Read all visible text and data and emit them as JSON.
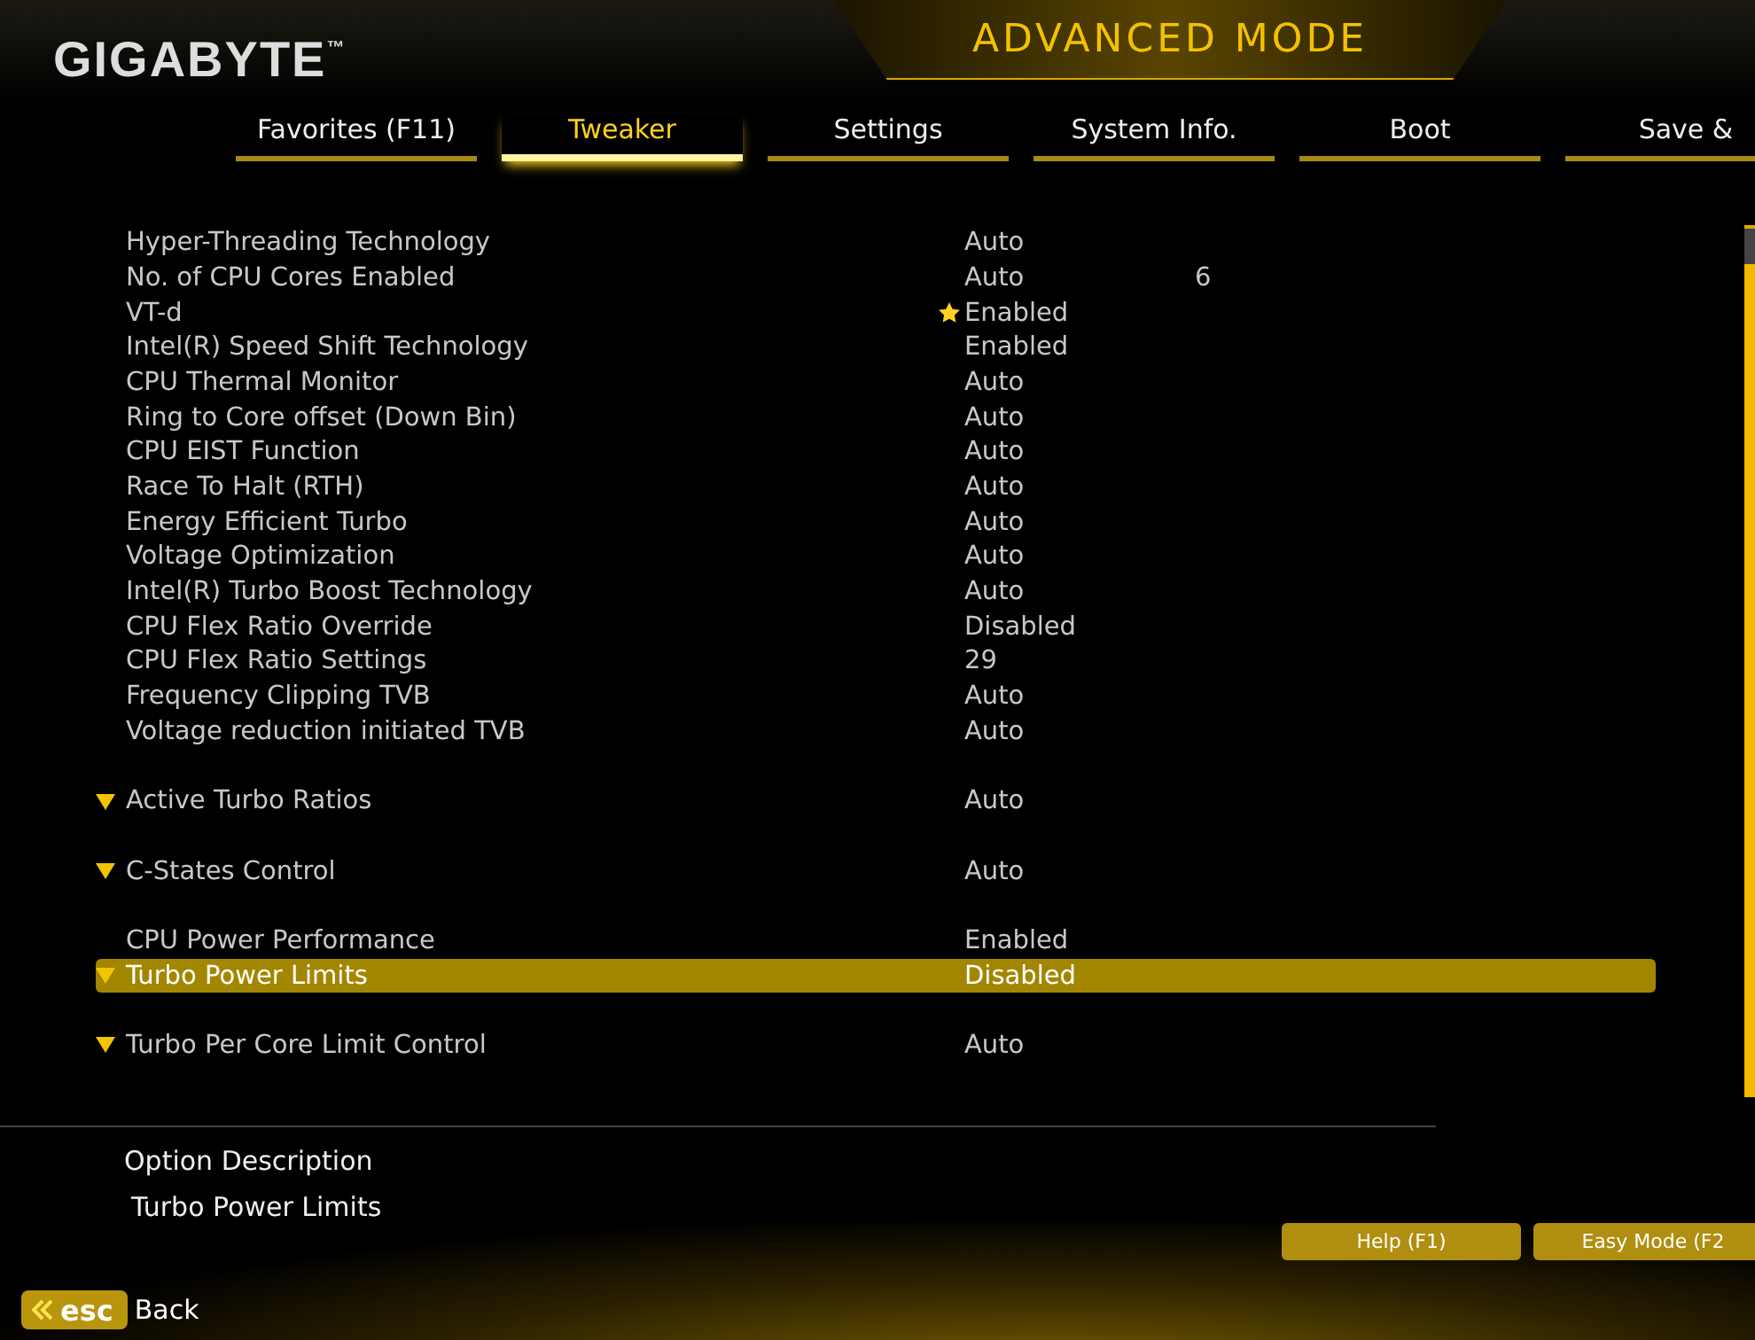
{
  "header": {
    "logo": "GIGABYTE",
    "trademark": "™",
    "mode_title": "ADVANCED MODE"
  },
  "tabs": [
    {
      "label": "Favorites (F11)",
      "selected": false
    },
    {
      "label": "Tweaker",
      "selected": true
    },
    {
      "label": "Settings",
      "selected": false
    },
    {
      "label": "System Info.",
      "selected": false
    },
    {
      "label": "Boot",
      "selected": false
    },
    {
      "label": "Save &",
      "selected": false
    }
  ],
  "settings": [
    {
      "kind": "setting",
      "label": "Hyper-Threading Technology",
      "value": "Auto",
      "favorite": false,
      "selected": false
    },
    {
      "kind": "setting",
      "label": "No. of CPU Cores Enabled",
      "value": "Auto",
      "extra": "6",
      "favorite": false,
      "selected": false
    },
    {
      "kind": "setting",
      "label": "VT-d",
      "value": "Enabled",
      "favorite": true,
      "selected": false
    },
    {
      "kind": "setting",
      "label": "Intel(R) Speed Shift Technology",
      "value": "Enabled",
      "favorite": false,
      "selected": false
    },
    {
      "kind": "setting",
      "label": "CPU Thermal Monitor",
      "value": "Auto",
      "favorite": false,
      "selected": false
    },
    {
      "kind": "setting",
      "label": "Ring to Core offset (Down Bin)",
      "value": "Auto",
      "favorite": false,
      "selected": false
    },
    {
      "kind": "setting",
      "label": "CPU EIST Function",
      "value": "Auto",
      "favorite": false,
      "selected": false
    },
    {
      "kind": "setting",
      "label": "Race To Halt (RTH)",
      "value": "Auto",
      "favorite": false,
      "selected": false
    },
    {
      "kind": "setting",
      "label": "Energy Efficient Turbo",
      "value": "Auto",
      "favorite": false,
      "selected": false
    },
    {
      "kind": "setting",
      "label": "Voltage Optimization",
      "value": "Auto",
      "favorite": false,
      "selected": false
    },
    {
      "kind": "setting",
      "label": "Intel(R) Turbo Boost Technology",
      "value": "Auto",
      "favorite": false,
      "selected": false
    },
    {
      "kind": "setting",
      "label": "CPU Flex Ratio Override",
      "value": "Disabled",
      "favorite": false,
      "selected": false
    },
    {
      "kind": "setting",
      "label": "CPU Flex Ratio Settings",
      "value": "29",
      "favorite": false,
      "selected": false
    },
    {
      "kind": "setting",
      "label": "Frequency Clipping TVB",
      "value": "Auto",
      "favorite": false,
      "selected": false
    },
    {
      "kind": "setting",
      "label": "Voltage reduction initiated TVB",
      "value": "Auto",
      "favorite": false,
      "selected": false
    },
    {
      "kind": "spacer"
    },
    {
      "kind": "submenu",
      "label": "Active Turbo Ratios",
      "value": "Auto",
      "favorite": false,
      "selected": false
    },
    {
      "kind": "spacer"
    },
    {
      "kind": "submenu",
      "label": "C-States Control",
      "value": "Auto",
      "favorite": false,
      "selected": false
    },
    {
      "kind": "spacer"
    },
    {
      "kind": "setting",
      "label": "CPU Power Performance",
      "value": "Enabled",
      "favorite": false,
      "selected": false
    },
    {
      "kind": "submenu",
      "label": "Turbo Power Limits",
      "value": "Disabled",
      "favorite": false,
      "selected": true
    },
    {
      "kind": "spacer"
    },
    {
      "kind": "submenu",
      "label": "Turbo Per Core Limit Control",
      "value": "Auto",
      "favorite": false,
      "selected": false
    }
  ],
  "description": {
    "heading": "Option Description",
    "text": "Turbo Power Limits"
  },
  "buttons": [
    {
      "label": "Help (F1)"
    },
    {
      "label": "Easy Mode (F2"
    }
  ],
  "back": {
    "key": "esc",
    "label": "Back"
  }
}
